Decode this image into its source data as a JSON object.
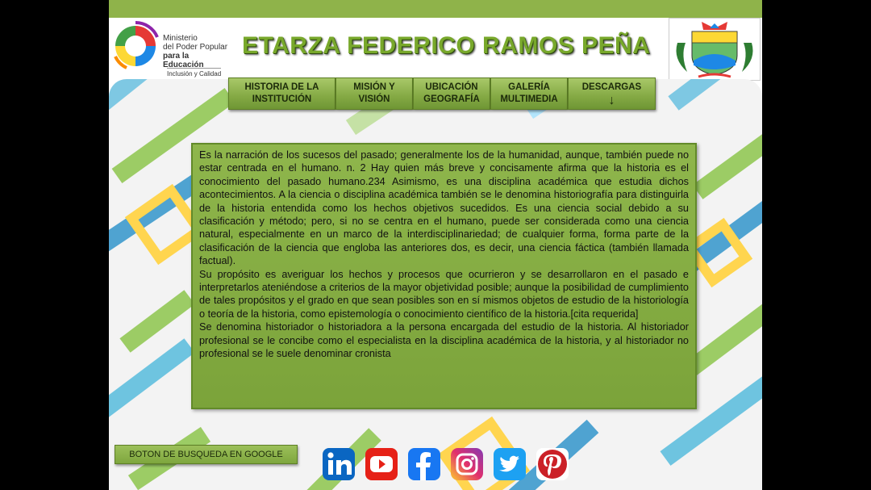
{
  "ministry": {
    "line1": "Ministerio",
    "line2": "del Poder Popular",
    "line3": "para la Educación",
    "tagline": "Inclusión y Calidad"
  },
  "site_title": "ETARZA FEDERICO RAMOS PEÑA",
  "nav": {
    "items": [
      {
        "line1": "HISTORIA DE LA",
        "line2": "INSTITUCIÓN"
      },
      {
        "line1": "MISIÓN Y",
        "line2": "VISIÓN"
      },
      {
        "line1": "UBICACIÓN",
        "line2": "GEOGRAFÍA"
      },
      {
        "line1": "GALERÍA",
        "line2": "MULTIMEDIA"
      },
      {
        "line1": "DESCARGAS",
        "line2": "↓"
      }
    ]
  },
  "content": {
    "paragraphs": [
      " Es la narración de los sucesos del pasado; generalmente los de la humanidad, aunque, también puede no estar centrada en el humano. n. 2 Hay quien más breve y concisamente afirma que la historia es el conocimiento del pasado humano.234 Asimismo, es una disciplina académica que estudia dichos acontecimientos. A la ciencia o disciplina académica también se le denomina historiografía para distinguirla de la historia entendida como los hechos objetivos sucedidos. Es una ciencia social debido a su clasificación y método; pero, si no se centra en el humano, puede ser considerada como una ciencia natural, especialmente en un marco de la interdisciplinariedad; de cualquier forma, forma parte de la clasificación de la ciencia que engloba las anteriores dos, es decir, una ciencia fáctica (también llamada factual).",
      "Su propósito es averiguar los hechos y procesos que ocurrieron y se desarrollaron en el pasado e interpretarlos ateniéndose a criterios de la mayor objetividad posible; aunque la posibilidad de cumplimiento de tales propósitos y el grado en que sean posibles son en sí mismos objetos de estudio de la historiología o teoría de la historia, como epistemología o conocimiento científico de la historia.[cita requerida]",
      "Se denomina historiador o historiadora a la persona encargada del estudio de la historia. Al historiador profesional se le concibe como el especialista en la disciplina académica de la historia, y al historiador no profesional se le suele denominar cronista"
    ]
  },
  "search_button": "BOTON DE BUSQUEDA EN GOOGLE",
  "social": [
    "linkedin-icon",
    "youtube-icon",
    "facebook-icon",
    "instagram-icon",
    "twitter-icon",
    "pinterest-icon"
  ],
  "colors": {
    "accent_green": "#7ba33a",
    "title_green": "#78a82b",
    "linkedin": "#0a66c2",
    "youtube": "#e62117",
    "facebook": "#1877f2",
    "twitter": "#1da1f2",
    "pinterest": "#cb2027"
  }
}
